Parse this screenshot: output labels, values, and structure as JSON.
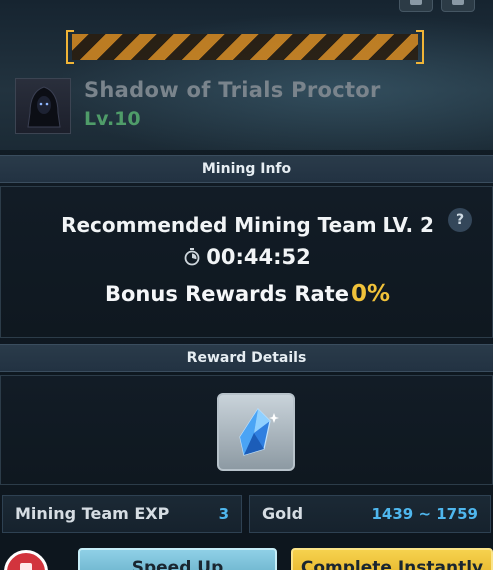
{
  "boss": {
    "name": "Shadow of Trials Proctor",
    "level": "Lv.10"
  },
  "mining_info": {
    "section_title": "Mining Info",
    "recommended_label": "Recommended Mining Team",
    "recommended_level": "LV. 2",
    "help_symbol": "?",
    "timer": "00:44:52",
    "bonus_label": "Bonus Rewards Rate",
    "bonus_value": "0%"
  },
  "reward_details": {
    "section_title": "Reward Details",
    "item_icon": "blue-crystal-icon",
    "stats": [
      {
        "label": "Mining Team EXP",
        "value": "3"
      },
      {
        "label": "Gold",
        "value": "1439 ~ 1759"
      }
    ]
  },
  "actions": {
    "speed_up_label": "Speed Up",
    "complete_label": "Complete Instantly"
  },
  "colors": {
    "accent_gold": "#f0c23a",
    "value_blue": "#4fb7ee",
    "level_green": "#4f9c69",
    "hazard_orange": "#d88a1f"
  }
}
